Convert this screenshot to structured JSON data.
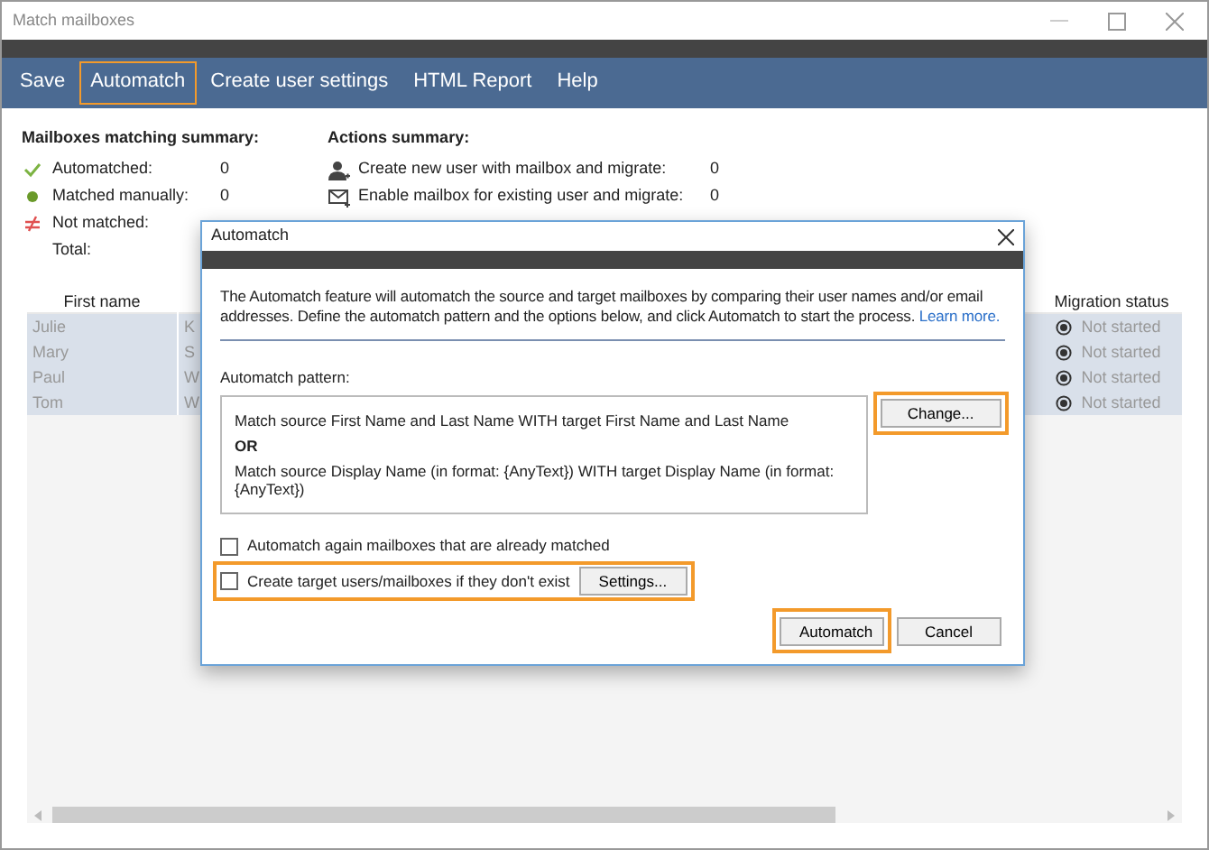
{
  "window": {
    "title": "Match mailboxes"
  },
  "menu": [
    {
      "label": "Save",
      "highlighted": false
    },
    {
      "label": "Automatch",
      "highlighted": true
    },
    {
      "label": "Create user settings",
      "highlighted": false
    },
    {
      "label": "HTML Report",
      "highlighted": false
    },
    {
      "label": "Help",
      "highlighted": false
    }
  ],
  "matching_summary": {
    "title": "Mailboxes matching summary:",
    "items": [
      {
        "kind": "automatched",
        "label": "Automatched:",
        "value": "0"
      },
      {
        "kind": "manual",
        "label": "Matched manually:",
        "value": "0"
      },
      {
        "kind": "not_matched",
        "label": "Not matched:"
      },
      {
        "kind": "total",
        "label": "Total:"
      }
    ]
  },
  "actions_summary": {
    "title": "Actions summary:",
    "items": [
      {
        "kind": "create_user",
        "label": "Create new user with mailbox and migrate:",
        "value": "0"
      },
      {
        "kind": "enable_mailbox",
        "label": "Enable mailbox for existing user and migrate:",
        "value": "0"
      }
    ]
  },
  "table": {
    "columns": [
      "First name",
      "Migration status"
    ],
    "rows": [
      {
        "first_name": "Julie",
        "column_2": "K",
        "migration_status": "Not started"
      },
      {
        "first_name": "Mary",
        "column_2": "S",
        "migration_status": "Not started"
      },
      {
        "first_name": "Paul",
        "column_2": "W",
        "migration_status": "Not started"
      },
      {
        "first_name": "Tom",
        "column_2": "W",
        "migration_status": "Not started"
      }
    ]
  },
  "dialog": {
    "title": "Automatch",
    "description": "The Automatch feature will automatch the source and target mailboxes by comparing their user names and/or email addresses. Define the automatch pattern and the options below, and click Automatch to start the process.",
    "link": "Learn more.",
    "pattern_label": "Automatch pattern:",
    "pattern_lines": [
      {
        "kind": "rule",
        "text": "Match source First Name and Last Name WITH target First Name and Last Name"
      },
      {
        "kind": "operator",
        "text": "OR"
      },
      {
        "kind": "rule",
        "text": "Match source Display Name (in format: {AnyText}) WITH target Display Name (in format: {AnyText})"
      }
    ],
    "change_button": {
      "label": "Change...",
      "highlighted": true
    },
    "options": [
      {
        "label": "Automatch again mailboxes that are already matched",
        "checked": false
      },
      {
        "label": "Create target users/mailboxes if they don't exist",
        "checked": false,
        "highlighted": true,
        "button": "Settings..."
      }
    ],
    "buttons": [
      {
        "label": "Automatch",
        "highlighted": true
      },
      {
        "label": "Cancel"
      }
    ]
  }
}
